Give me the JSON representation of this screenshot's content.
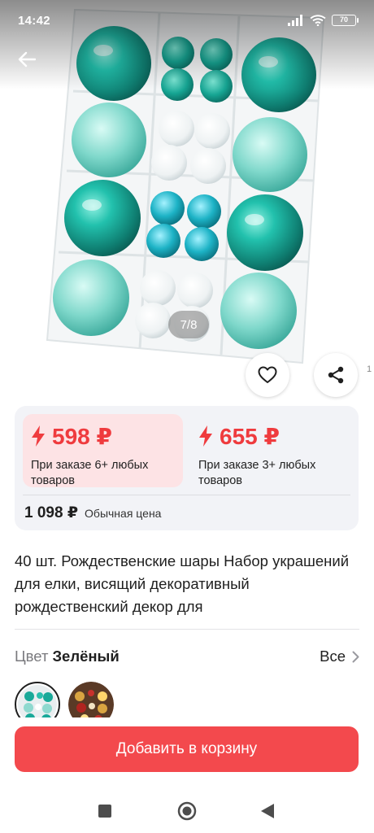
{
  "status_bar": {
    "time": "14:42",
    "battery": "70"
  },
  "gallery": {
    "counter": "7/8",
    "edge_number": "1"
  },
  "offers": [
    {
      "price": "598 ₽",
      "condition": "При заказе 6+ любых товаров"
    },
    {
      "price": "655 ₽",
      "condition": "При заказе 3+ любых товаров"
    }
  ],
  "regular": {
    "price": "1 098 ₽",
    "label": "Обычная цена"
  },
  "product": {
    "title": "40 шт. Рождественские шары Набор украшений для елки, висящий декоративный рождественский декор для"
  },
  "color": {
    "label": "Цвет",
    "value": "Зелёный",
    "all": "Все"
  },
  "cart": {
    "button": "Добавить в корзину"
  },
  "icons": {
    "back": "arrow-left-icon",
    "favorite": "heart-icon",
    "share": "share-icon",
    "bolt": "lightning-icon",
    "chevron": "chevron-right-icon",
    "nav": [
      "square-icon",
      "circle-icon",
      "triangle-back-icon"
    ]
  },
  "colors": {
    "accent": "#ef3b3e",
    "button": "#f3494d",
    "offer_bg": "#fde3e5",
    "card_bg": "#f2f3f7",
    "teal": "#1aa89a"
  }
}
